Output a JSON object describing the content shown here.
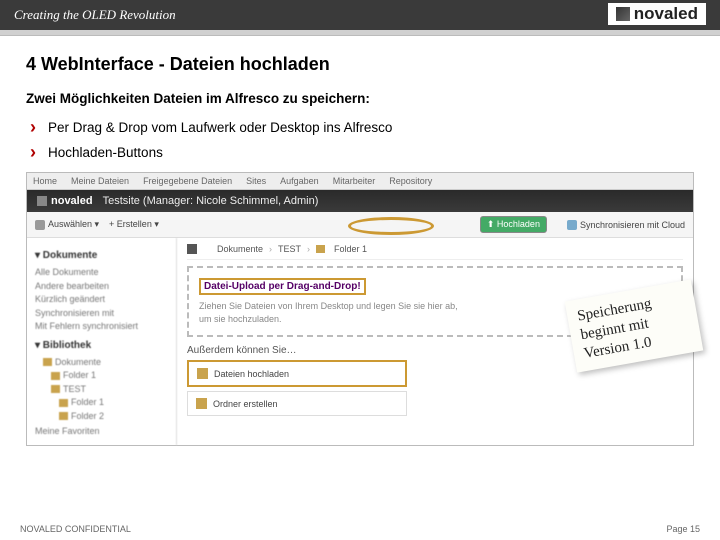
{
  "header": {
    "tagline": "Creating the OLED Revolution",
    "logo_text": "novaled"
  },
  "page": {
    "title": "4 WebInterface - Dateien hochladen",
    "subheading": "Zwei Möglichkeiten Dateien im Alfresco zu speichern:",
    "bullets": [
      "Per Drag & Drop vom Laufwerk oder Desktop ins Alfresco",
      "Hochladen-Buttons"
    ]
  },
  "annotation": {
    "line1": "Speicherung",
    "line2": "beginnt mit",
    "line3": "Version 1.0"
  },
  "screenshot": {
    "tabs": [
      "Home",
      "Meine Dateien",
      "Freigegebene Dateien",
      "Sites",
      "Aufgaben",
      "Mitarbeiter",
      "Repository"
    ],
    "site_logo": "novaled",
    "site_title": "Testsite (Manager: Nicole Schimmel, Admin)",
    "toolbar": {
      "select": "Auswählen ▾",
      "create": "+ Erstellen ▾",
      "upload": "⬆ Hochladen",
      "sync": "Synchronisieren mit Cloud"
    },
    "breadcrumb": [
      "Dokumente",
      "TEST",
      "Folder 1"
    ],
    "left": {
      "section1": "▾ Dokumente",
      "items1": [
        "Alle Dokumente",
        "Andere bearbeiten",
        "Kürzlich geändert",
        "Synchronisieren mit",
        "Mit Fehlern synchronisiert"
      ],
      "section2": "▾ Bibliothek",
      "tree_root": "Dokumente",
      "tree1": "Folder 1",
      "tree2": "TEST",
      "tree2a": "Folder 1",
      "tree2b": "Folder 2",
      "fav": "Meine Favoriten"
    },
    "dropzone": {
      "title": "Datei-Upload per Drag-and-Drop!",
      "sub": "Ziehen Sie Dateien von Ihrem Desktop und legen Sie sie hier ab, um sie hochzuladen."
    },
    "also": {
      "heading": "Außerdem können Sie…",
      "upload": "Dateien hochladen",
      "create": "Ordner erstellen"
    }
  },
  "footer": {
    "left": "NOVALED CONFIDENTIAL",
    "right": "Page 15"
  }
}
